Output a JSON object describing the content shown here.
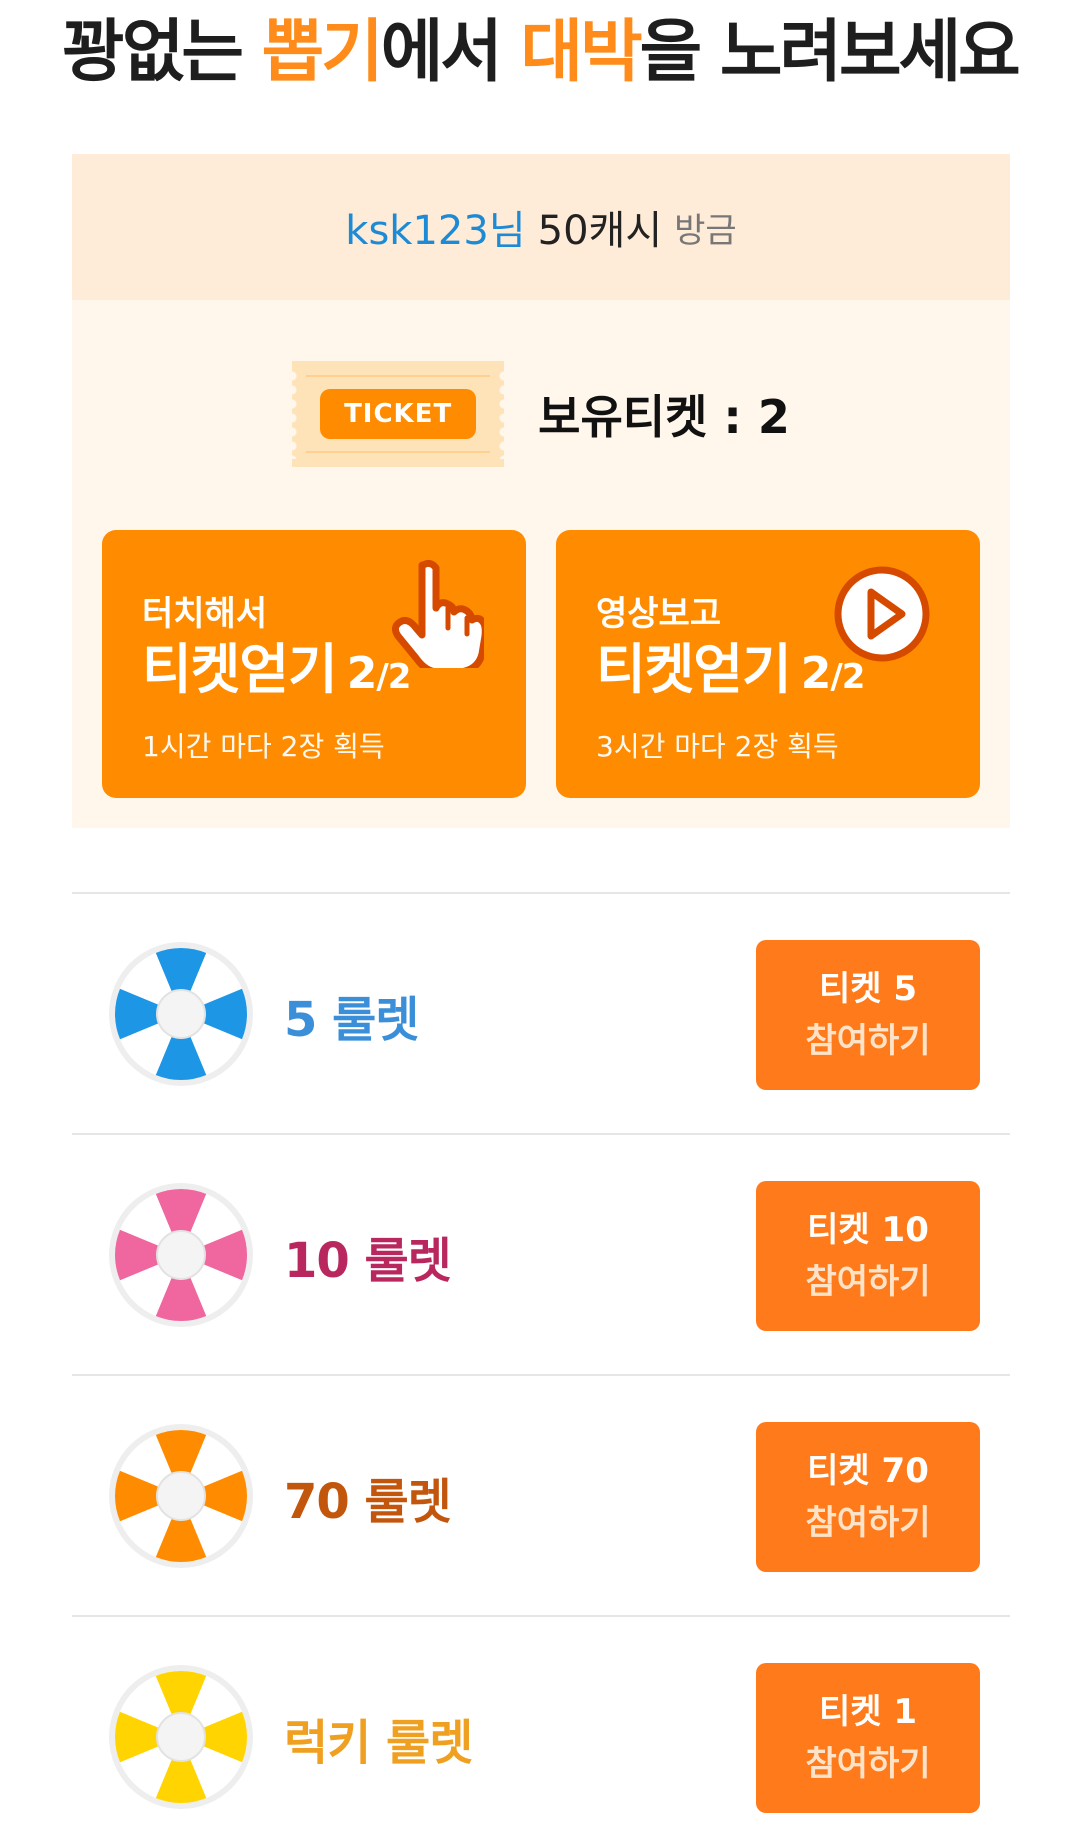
{
  "headline": {
    "part1": "꽝없는 ",
    "part2": "뽑기",
    "part3": "에서 ",
    "part4": "대박",
    "part5": "을 노려보세요"
  },
  "user": {
    "name": "ksk123님",
    "cash": "50캐시",
    "time": "방금"
  },
  "ticket": {
    "label": "TICKET",
    "owned_text": "보유티켓 : 2"
  },
  "earn_buttons": [
    {
      "sub": "터치해서",
      "main": "티켓얻기",
      "current": "2",
      "max": "2",
      "note": "1시간 마다 2장 획득",
      "icon": "hand-pointer-icon"
    },
    {
      "sub": "영상보고",
      "main": "티켓얻기",
      "current": "2",
      "max": "2",
      "note": "3시간 마다 2장 획득",
      "icon": "play-circle-icon"
    }
  ],
  "roulettes": [
    {
      "name": "5 룰렛",
      "ticket": "티켓 5",
      "join": "참여하기",
      "color": "#1e96e6",
      "label_color": "#3a8fd8"
    },
    {
      "name": "10 룰렛",
      "ticket": "티켓 10",
      "join": "참여하기",
      "color": "#f0669e",
      "label_color": "#b8275e"
    },
    {
      "name": "70 룰렛",
      "ticket": "티켓 70",
      "join": "참여하기",
      "color": "#ff8c00",
      "label_color": "#c2560c"
    },
    {
      "name": "럭키 룰렛",
      "ticket": "티켓 1",
      "join": "참여하기",
      "color": "#ffd400",
      "label_color": "#f0a020"
    }
  ]
}
